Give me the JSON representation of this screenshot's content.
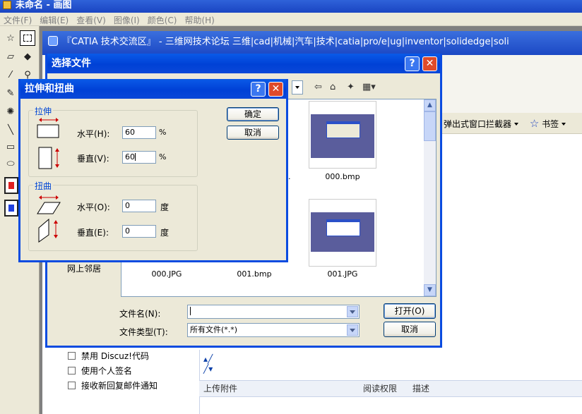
{
  "paint": {
    "title": "未命名 - 画图",
    "menu": [
      "文件(F)",
      "编辑(E)",
      "查看(V)",
      "图像(I)",
      "颜色(C)",
      "帮助(H)"
    ]
  },
  "browser": {
    "header_text": "『CATIA 技术交流区』 - 三维网技术论坛 三维|cad|机械|汽车|技术|catia|pro/e|ug|inventor|solidedge|soli",
    "popup_blocker": "弹出式窗口拦截器",
    "bookmarks": "书签",
    "options": [
      "禁用 Discuz!代码",
      "使用个人签名",
      "接收新回复邮件通知"
    ],
    "upload_col1": "上传附件",
    "upload_col2": "阅读权限",
    "upload_col3": "描述"
  },
  "file_dialog": {
    "title": "选择文件",
    "files": [
      {
        "name": "000.bmp"
      },
      {
        "name": "000.JPG"
      },
      {
        "name": "001.bmp"
      },
      {
        "name": "001.JPG"
      }
    ],
    "partial_label": "..",
    "network_places": "网上邻居",
    "filename_label": "文件名(N):",
    "filename_value": "",
    "filetype_label": "文件类型(T):",
    "filetype_value": "所有文件(*.*)",
    "open_button": "打开(O)",
    "cancel_button": "取消"
  },
  "stretch_dialog": {
    "title": "拉伸和扭曲",
    "stretch_group": "拉伸",
    "skew_group": "扭曲",
    "horizontal_label": "水平(H):",
    "vertical_label": "垂直(V):",
    "skew_horizontal_label": "水平(O):",
    "skew_vertical_label": "垂直(E):",
    "stretch_h": "60",
    "stretch_v": "60",
    "skew_h": "0",
    "skew_v": "0",
    "percent": "%",
    "degree": "度",
    "ok_button": "确定",
    "cancel_button": "取消",
    "help_btn": "?",
    "close_btn": "✕"
  },
  "colors": {
    "xp_blue": "#0a5ae8",
    "close_red": "#e04a2a"
  }
}
